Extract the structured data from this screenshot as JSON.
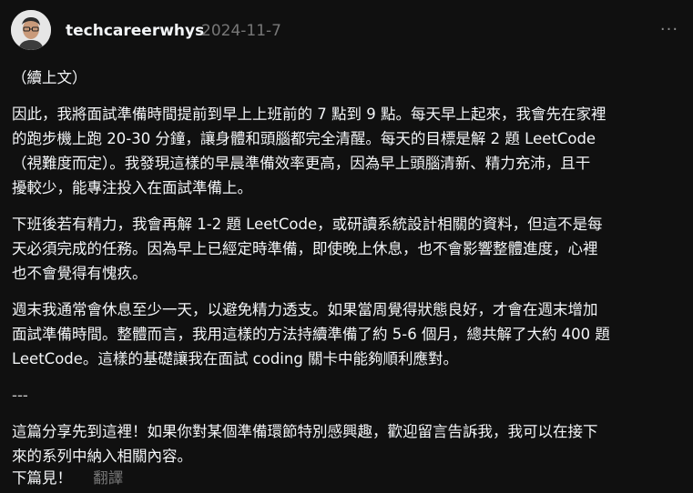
{
  "header": {
    "username": "techcareerwhys",
    "timestamp": "2024-11-7",
    "more_label": "···"
  },
  "content": {
    "lines": [
      "（續上文）",
      "因此，我將面試準備時間提前到早上上班前的 7 點到 9 點。每天早上起來，我會先在家裡\n的跑步機上跑 20-30 分鐘，讓身體和頭腦都完全清醒。每天的目標是解 2 題 LeetCode\n（視難度而定）。我發現這樣的早晨準備效率更高，因為早上頭腦清新、精力充沛，且干\n擾較少，能專注投入在面試準備上。",
      "下班後若有精力，我會再解 1-2 題 LeetCode，或研讀系統設計相關的資料，但這不是每\n天必須完成的任務。因為早上已經定時準備，即使晚上休息，也不會影響整體進度，心裡\n也不會覺得有愧疚。",
      "週末我通常會休息至少一天，以避免精力透支。如果當周覺得狀態良好，才會在週末增加\n面試準備時間。整體而言，我用這樣的方法持續準備了約 5-6 個月，總共解了大約 400 題\nLeetCode。這樣的基礎讓我在面試 coding 關卡中能夠順利應對。",
      "---",
      "這篇分享先到這裡！如果你對某個準備環節特別感興趣，歡迎留言告訴我，我可以在接下\n來的系列中納入相關內容。"
    ]
  },
  "footer": {
    "sign_off": "下篇見！",
    "translate_label": "翻譯"
  }
}
